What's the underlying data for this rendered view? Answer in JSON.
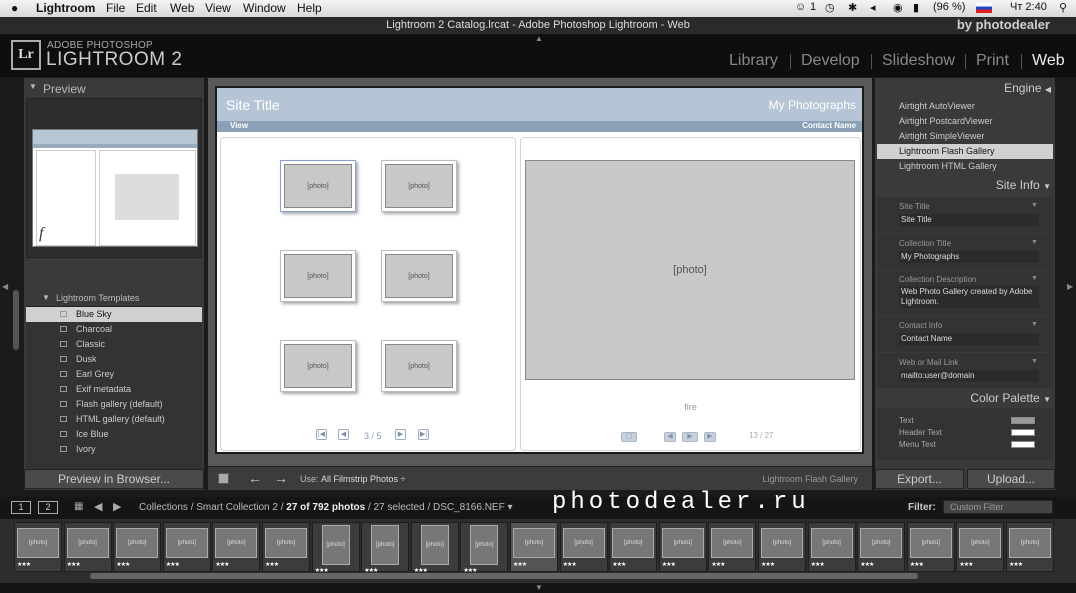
{
  "menubar": {
    "apple": "",
    "app": "Lightroom",
    "items": [
      "File",
      "Edit",
      "Web",
      "View",
      "Window",
      "Help"
    ],
    "status": {
      "user_count": "1",
      "battery": "(96 %)",
      "clock": "Чт 2:40"
    }
  },
  "window": {
    "title": "Lightroom 2 Catalog.lrcat - Adobe Photoshop Lightroom - Web",
    "brand_watermark": "by photodealer"
  },
  "identity": {
    "logo": "Lr",
    "line1": "ADOBE PHOTOSHOP",
    "line2": "LIGHTROOM 2",
    "modules": [
      "Library",
      "Develop",
      "Slideshow",
      "Print",
      "Web"
    ],
    "active_module": "Web"
  },
  "left": {
    "preview_title": "Preview",
    "templates_title": "Lightroom Templates",
    "templates": [
      "Blue Sky",
      "Charcoal",
      "Classic",
      "Dusk",
      "Earl Grey",
      "Exif metadata",
      "Flash gallery (default)",
      "HTML gallery (default)",
      "Ice Blue",
      "Ivory"
    ],
    "selected_template": "Blue Sky",
    "browser_button": "Preview in Browser..."
  },
  "site": {
    "title": "Site Title",
    "collection": "My Photographs",
    "nav_view": "View",
    "nav_contact": "Contact Name",
    "pager": "3 / 5",
    "caption": "fire",
    "counter": "13 / 27"
  },
  "toolbar": {
    "use_label": "Use:",
    "use_value": "All Filmstrip Photos ÷",
    "gallery": "Lightroom Flash Gallery"
  },
  "right": {
    "engine_title": "Engine",
    "engines": [
      "Airtight AutoViewer",
      "Airtight PostcardViewer",
      "Airtight SimpleViewer",
      "Lightroom Flash Gallery",
      "Lightroom HTML Gallery"
    ],
    "selected_engine": "Lightroom Flash Gallery",
    "siteinfo_title": "Site Info",
    "site_title_label": "Site Title",
    "site_title_value": "Site Title",
    "collection_title_label": "Collection Title",
    "collection_title_value": "My Photographs",
    "collection_desc_label": "Collection Description",
    "collection_desc_value": "Web Photo Gallery created by Adobe Lightroom.",
    "contact_label": "Contact Info",
    "contact_value": "Contact Name",
    "web_link_label": "Web or Mail Link",
    "web_link_value": "mailto:user@domain",
    "palette_title": "Color Palette",
    "palette": [
      {
        "label": "Text",
        "color": "#9a9a9a"
      },
      {
        "label": "Header Text",
        "color": "#ffffff"
      },
      {
        "label": "Menu Text",
        "color": "#ffffff"
      }
    ],
    "export_button": "Export...",
    "upload_button": "Upload..."
  },
  "filmbar": {
    "view1": "1",
    "view2": "2",
    "crumb_prefix": "Collections / Smart Collection 2 / ",
    "crumb_count": "27 of 792 photos",
    "crumb_suffix": " / 27 selected / DSC_8166.NEF ▾",
    "watermark": "photodealer.ru",
    "filter_label": "Filter:",
    "filter_value": "Custom Filter"
  },
  "filmstrip": {
    "placeholder": "[photo]",
    "stars": "★★★",
    "orientations": [
      "l",
      "l",
      "l",
      "l",
      "l",
      "l",
      "p",
      "p",
      "p",
      "p",
      "l",
      "l",
      "l",
      "l",
      "l",
      "l",
      "l",
      "l",
      "l",
      "l",
      "l"
    ],
    "selected_index": 10
  }
}
